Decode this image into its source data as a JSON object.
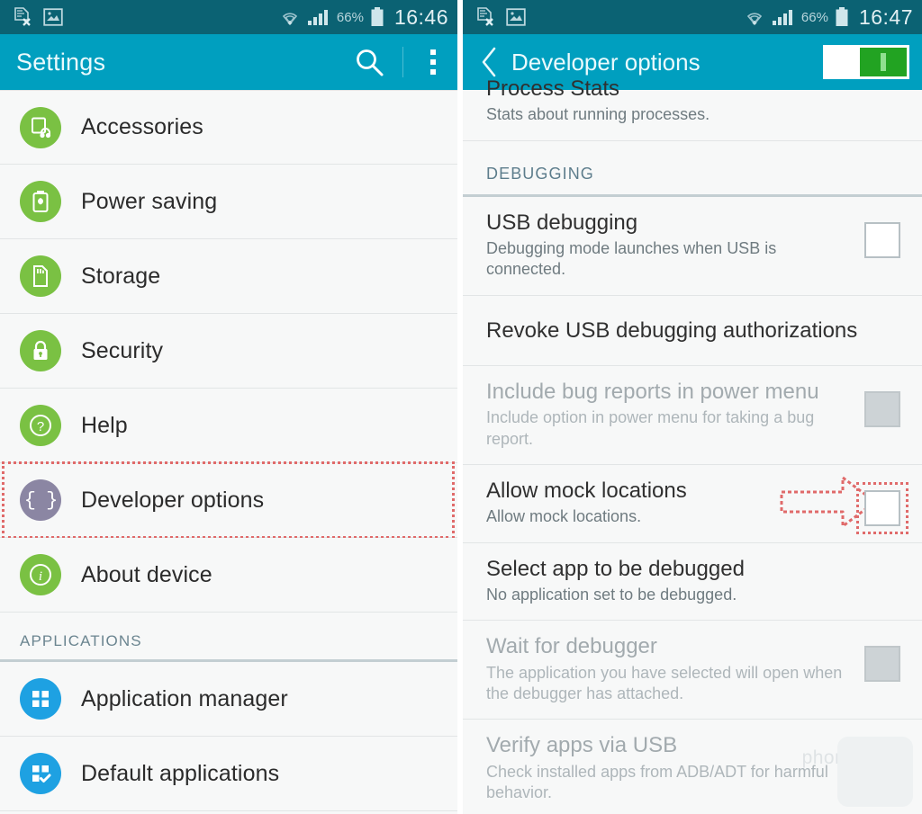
{
  "left": {
    "statusbar": {
      "icons": [
        "document-x-icon",
        "picture-icon",
        "wifi-icon",
        "signal-icon"
      ],
      "battery_percent": "66%",
      "time": "16:46"
    },
    "actionbar": {
      "title": "Settings",
      "search_icon": "search-icon",
      "overflow_icon": "more-vertical-icon"
    },
    "items": [
      {
        "label": "Accessories",
        "icon": "accessories-icon",
        "color": "green"
      },
      {
        "label": "Power saving",
        "icon": "battery-leaf-icon",
        "color": "green"
      },
      {
        "label": "Storage",
        "icon": "sdcard-icon",
        "color": "green"
      },
      {
        "label": "Security",
        "icon": "lock-icon",
        "color": "green"
      },
      {
        "label": "Help",
        "icon": "question-icon",
        "color": "green"
      },
      {
        "label": "Developer options",
        "icon": "braces-icon",
        "color": "purple",
        "highlighted": true
      },
      {
        "label": "About device",
        "icon": "info-icon",
        "color": "green"
      }
    ],
    "section_header": "APPLICATIONS",
    "app_items": [
      {
        "label": "Application manager",
        "icon": "grid-icon",
        "color": "blue"
      },
      {
        "label": "Default applications",
        "icon": "grid-check-icon",
        "color": "blue"
      }
    ]
  },
  "right": {
    "statusbar": {
      "battery_percent": "66%",
      "time": "16:47"
    },
    "actionbar": {
      "back_icon": "chevron-left-icon",
      "title": "Developer options",
      "master_switch": {
        "name": "developer-options-toggle",
        "state": "on"
      }
    },
    "clipped_row": {
      "title": "Process Stats",
      "subtitle": "Stats about running processes."
    },
    "section_header": "DEBUGGING",
    "settings": [
      {
        "title": "USB debugging",
        "subtitle": "Debugging mode launches when USB is connected.",
        "checkbox": "unchecked",
        "dim": false
      },
      {
        "title": "Revoke USB debugging authorizations",
        "subtitle": "",
        "checkbox": "none",
        "dim": false
      },
      {
        "title": "Include bug reports in power menu",
        "subtitle": "Include option in power menu for taking a bug report.",
        "checkbox": "disabled",
        "dim": true
      },
      {
        "title": "Allow mock locations",
        "subtitle": "Allow mock locations.",
        "checkbox": "unchecked",
        "dim": false,
        "annotated": true
      },
      {
        "title": "Select app to be debugged",
        "subtitle": "No application set to be debugged.",
        "checkbox": "none",
        "dim": false
      },
      {
        "title": "Wait for debugger",
        "subtitle": "The application you have selected will open when the debugger has attached.",
        "checkbox": "disabled",
        "dim": true
      },
      {
        "title": "Verify apps via USB",
        "subtitle": "Check installed apps from ADB/ADT for harmful behavior.",
        "checkbox": "checked",
        "dim": true
      }
    ],
    "watermark": "phoneArena"
  },
  "colors": {
    "statusbar": "#0b6273",
    "actionbar": "#009fbf",
    "list_bg": "#f7f8f8",
    "icon_green": "#7ac143",
    "icon_purple": "#8b86a3",
    "icon_blue": "#1ea1e2",
    "annotation_red": "#e06a6a",
    "toggle_on_green": "#22a322"
  }
}
